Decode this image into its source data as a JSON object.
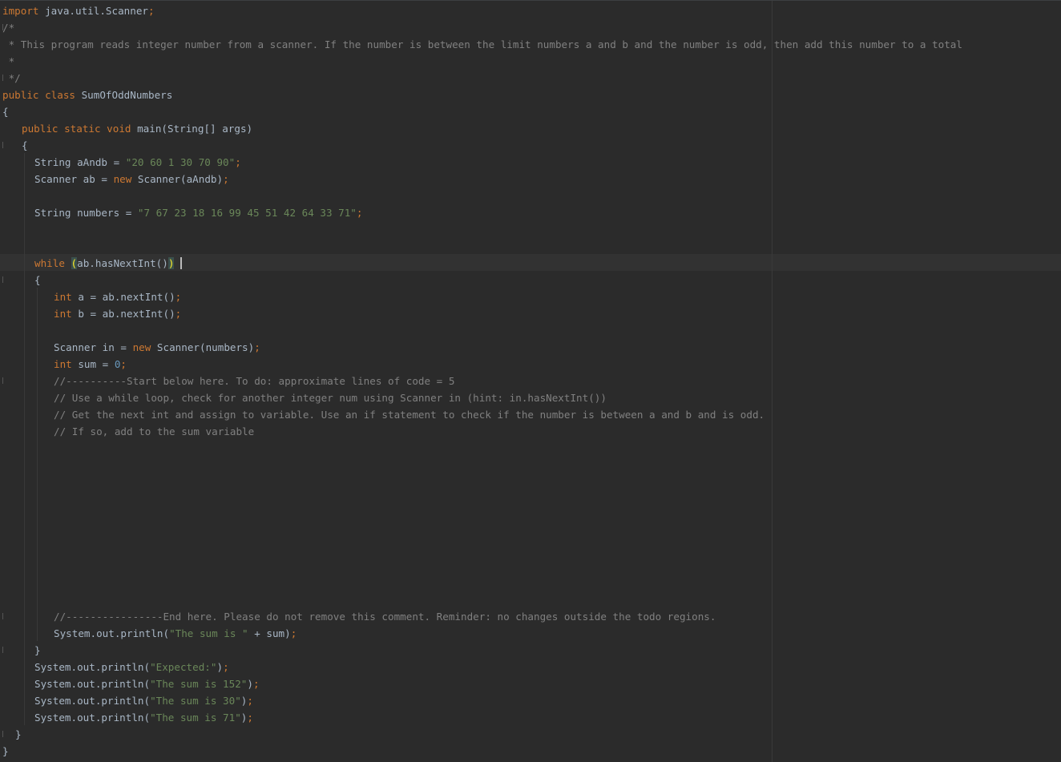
{
  "editor": {
    "colors": {
      "background": "#2b2b2b",
      "keyword": "#cc7832",
      "string": "#6a8759",
      "number": "#6897bb",
      "comment": "#808080",
      "text": "#a9b7c6"
    },
    "lines": {
      "l1": {
        "kw": "import",
        "t": " java.util.Scanner",
        "p": ";"
      },
      "l2": {
        "c": "/*"
      },
      "l3": {
        "c": " * This program reads integer number from a scanner. If the number is between the limit numbers a and b and the number is odd, then add this number to a total"
      },
      "l4": {
        "c": " *"
      },
      "l5": {
        "c": " */"
      },
      "l6": {
        "kw": "public class",
        "t": " SumOfOddNumbers"
      },
      "l7": {
        "t": "{"
      },
      "l8": {
        "kw": "public static void",
        "t": " main(String[] args)"
      },
      "l9": {
        "t": "{"
      },
      "l10": {
        "t": "String aAndb = ",
        "s": "\"20 60 1 30 70 90\"",
        "p": ";"
      },
      "l11": {
        "t1": "Scanner ab = ",
        "kw": "new",
        "t2": " Scanner(aAndb)",
        "p": ";"
      },
      "l12": {
        "t": "String numbers = ",
        "s": "\"7 67 23 18 16 99 45 51 42 64 33 71\"",
        "p": ";"
      },
      "l13": {
        "kw": "while",
        "sp": " ",
        "po": "(",
        "t": "ab.hasNextInt()",
        "pc": ")"
      },
      "l14": {
        "t": "{"
      },
      "l15": {
        "kw": "int",
        "t": " a = ab.nextInt()",
        "p": ";"
      },
      "l16": {
        "kw": "int",
        "t": " b = ab.nextInt()",
        "p": ";"
      },
      "l17": {
        "t1": "Scanner in = ",
        "kw": "new",
        "t2": " Scanner(numbers)",
        "p": ";"
      },
      "l18": {
        "kw": "int",
        "t": " sum = ",
        "n": "0",
        "p": ";"
      },
      "l19": {
        "c": "//----------Start below here. To do: approximate lines of code = 5"
      },
      "l20": {
        "c": "// Use a while loop, check for another integer num using Scanner in (hint: in.hasNextInt())"
      },
      "l21": {
        "c": "// Get the next int and assign to variable. Use an if statement to check if the number is between a and b and is odd."
      },
      "l22": {
        "c": "// If so, add to the sum variable"
      },
      "l23": {
        "c": "//----------------End here. Please do not remove this comment. Reminder: no changes outside the todo regions."
      },
      "l24": {
        "t": "System.out.println(",
        "s": "\"The sum is \"",
        "t2": " + sum)",
        "p": ";"
      },
      "l25": {
        "t": "}"
      },
      "l26": {
        "t": "System.out.println(",
        "s": "\"Expected:\"",
        "t2": ")",
        "p": ";"
      },
      "l27": {
        "t": "System.out.println(",
        "s": "\"The sum is 152\"",
        "t2": ")",
        "p": ";"
      },
      "l28": {
        "t": "System.out.println(",
        "s": "\"The sum is 30\"",
        "t2": ")",
        "p": ";"
      },
      "l29": {
        "t": "System.out.println(",
        "s": "\"The sum is 71\"",
        "t2": ")",
        "p": ";"
      },
      "l30": {
        "t": "}"
      },
      "l31": {
        "t": "}"
      }
    }
  }
}
